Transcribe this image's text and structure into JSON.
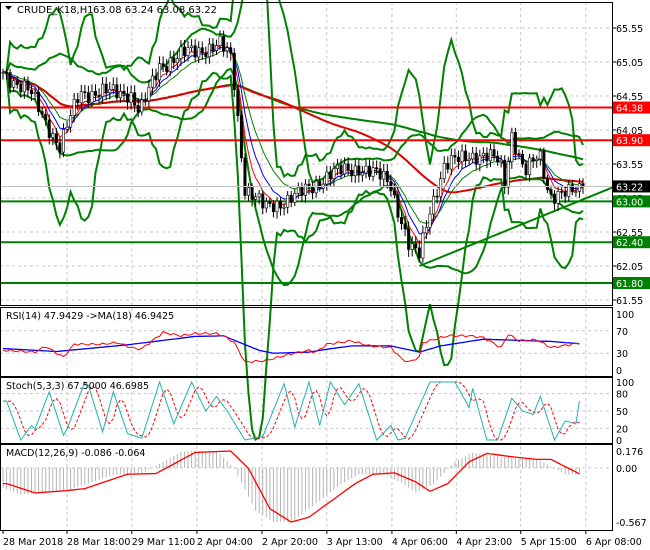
{
  "header": {
    "symbol_label": "CRUDE_K18,H1",
    "ohlc": "63.08 63.24 63.08 63.22"
  },
  "chart_data": {
    "type": "candlestick",
    "title": "CRUDE_K18,H1 63.08 63.24 63.08 63.22",
    "bars": 163,
    "ylim": [
      61.55,
      65.55
    ],
    "price_ticks": [
      "65.55",
      "65.05",
      "64.55",
      "64.05",
      "63.55",
      "63.05",
      "62.55",
      "62.05",
      "61.55"
    ],
    "close_keypoints": [
      [
        0,
        64.9
      ],
      [
        7.6,
        64.6
      ],
      [
        16,
        63.8
      ],
      [
        21.6,
        64.6
      ],
      [
        35.7,
        64.6
      ],
      [
        38.5,
        64.3
      ],
      [
        44,
        65.0
      ],
      [
        52.5,
        65.2
      ],
      [
        61,
        65.3
      ],
      [
        64.3,
        65.1
      ],
      [
        68,
        63.2
      ],
      [
        73.6,
        62.9
      ],
      [
        83.4,
        63.1
      ],
      [
        91.9,
        63.4
      ],
      [
        100,
        63.5
      ],
      [
        108.7,
        63.3
      ],
      [
        111.5,
        62.8
      ],
      [
        114.3,
        62.3
      ],
      [
        117,
        62.2
      ],
      [
        120,
        62.9
      ],
      [
        124,
        63.5
      ],
      [
        131,
        63.7
      ],
      [
        139.6,
        63.6
      ],
      [
        141,
        63.3
      ],
      [
        143,
        64.0
      ],
      [
        146.6,
        63.4
      ],
      [
        150.8,
        63.7
      ],
      [
        153.6,
        63.1
      ],
      [
        159,
        63.1
      ],
      [
        163,
        63.22
      ]
    ],
    "levels": [
      {
        "price": 64.38,
        "label": "64.38",
        "color": "#ff0000"
      },
      {
        "price": 63.9,
        "label": "63.90",
        "color": "#ff0000"
      },
      {
        "price": 63.0,
        "label": "63.00",
        "color": "#008000"
      },
      {
        "price": 62.4,
        "label": "62.40",
        "color": "#008000"
      },
      {
        "price": 61.8,
        "label": "61.80",
        "color": "#008000"
      }
    ],
    "current_price": {
      "price": 63.22,
      "label": "63.22"
    },
    "trendline": {
      "from": [
        117,
        62.05
      ],
      "to": [
        172,
        63.22
      ],
      "color": "#008000"
    },
    "x_labels": [
      {
        "bar": 0,
        "label": "28 Mar 2018"
      },
      {
        "bar": 18,
        "label": "28 Mar 18:00"
      },
      {
        "bar": 36.2,
        "label": "29 Mar 11:00"
      },
      {
        "bar": 54.5,
        "label": "2 Apr 04:00"
      },
      {
        "bar": 72.8,
        "label": "2 Apr 20:00"
      },
      {
        "bar": 91,
        "label": "3 Apr 13:00"
      },
      {
        "bar": 109.3,
        "label": "4 Apr 06:00"
      },
      {
        "bar": 127.4,
        "label": "4 Apr 23:00"
      },
      {
        "bar": 145.5,
        "label": "5 Apr 15:00"
      },
      {
        "bar": 163.8,
        "label": "6 Apr 08:00"
      }
    ],
    "rsi": {
      "title": "RSI(14) 47.9429  ->MA(18) 46.9425",
      "ticks": [
        "100",
        "70",
        "30",
        "0"
      ],
      "rsi_keypoints": [
        [
          1,
          35
        ],
        [
          9,
          32
        ],
        [
          12,
          42
        ],
        [
          17,
          23
        ],
        [
          20,
          46
        ],
        [
          28,
          46
        ],
        [
          32,
          49
        ],
        [
          37,
          38
        ],
        [
          39,
          38
        ],
        [
          45,
          67
        ],
        [
          50,
          61
        ],
        [
          54,
          65
        ],
        [
          60,
          65
        ],
        [
          62,
          61
        ],
        [
          65,
          49
        ],
        [
          68,
          14
        ],
        [
          74,
          17
        ],
        [
          81,
          29
        ],
        [
          86,
          35
        ],
        [
          88,
          32
        ],
        [
          91,
          46
        ],
        [
          98,
          52
        ],
        [
          103,
          43
        ],
        [
          109,
          40
        ],
        [
          112,
          20
        ],
        [
          114,
          14
        ],
        [
          117,
          23
        ],
        [
          118,
          49
        ],
        [
          125,
          61
        ],
        [
          131,
          61
        ],
        [
          135,
          58
        ],
        [
          140,
          40
        ],
        [
          142,
          64
        ],
        [
          145,
          52
        ],
        [
          150,
          54
        ],
        [
          154,
          40
        ],
        [
          162,
          48
        ]
      ],
      "ma_keypoints": [
        [
          1,
          38
        ],
        [
          15,
          33
        ],
        [
          35,
          45
        ],
        [
          54,
          60
        ],
        [
          62,
          61
        ],
        [
          72,
          35
        ],
        [
          76,
          30
        ],
        [
          86,
          32
        ],
        [
          92,
          38
        ],
        [
          98,
          43
        ],
        [
          109,
          43
        ],
        [
          117,
          32
        ],
        [
          123,
          43
        ],
        [
          135,
          55
        ],
        [
          154,
          51
        ],
        [
          162,
          47
        ]
      ]
    },
    "stoch": {
      "title": "Stoch(5,3,3) 67.5000 46.6985",
      "ticks": [
        "100",
        "80",
        "50",
        "20",
        "0"
      ],
      "main_keypoints": [
        [
          1,
          67
        ],
        [
          5,
          0
        ],
        [
          8,
          25
        ],
        [
          9,
          19
        ],
        [
          13,
          83
        ],
        [
          17,
          8
        ],
        [
          18,
          19
        ],
        [
          23,
          100
        ],
        [
          24,
          94
        ],
        [
          28,
          14
        ],
        [
          31,
          83
        ],
        [
          35,
          11
        ],
        [
          39,
          3
        ],
        [
          44,
          100
        ],
        [
          48,
          28
        ],
        [
          53,
          100
        ],
        [
          57,
          50
        ],
        [
          60,
          75
        ],
        [
          63,
          50
        ],
        [
          68,
          0
        ],
        [
          73,
          6
        ],
        [
          79,
          97
        ],
        [
          82,
          22
        ],
        [
          86,
          100
        ],
        [
          89,
          25
        ],
        [
          92,
          100
        ],
        [
          96,
          61
        ],
        [
          100,
          97
        ],
        [
          105,
          0
        ],
        [
          109,
          25
        ],
        [
          111,
          0
        ],
        [
          113,
          3
        ],
        [
          120,
          100
        ],
        [
          127,
          100
        ],
        [
          131,
          56
        ],
        [
          132,
          89
        ],
        [
          136,
          0
        ],
        [
          139,
          0
        ],
        [
          143,
          72
        ],
        [
          146,
          50
        ],
        [
          149,
          44
        ],
        [
          151,
          75
        ],
        [
          155,
          0
        ],
        [
          158,
          33
        ],
        [
          161,
          28
        ],
        [
          162,
          67.5
        ]
      ]
    },
    "macd": {
      "title": "MACD(12,26,9) -0.086 -0.064",
      "ticks": [
        "0.176",
        "0.00",
        "-0.567"
      ],
      "range": [
        -0.567,
        0.176
      ],
      "signal_keypoints": [
        [
          1,
          -0.165
        ],
        [
          9,
          -0.263
        ],
        [
          17,
          -0.242
        ],
        [
          23,
          -0.218
        ],
        [
          35,
          -0.067
        ],
        [
          43,
          -0.06
        ],
        [
          54,
          0.161
        ],
        [
          64,
          0.176
        ],
        [
          69,
          -0.007
        ],
        [
          75,
          -0.428
        ],
        [
          81,
          -0.567
        ],
        [
          86,
          -0.516
        ],
        [
          99,
          -0.165
        ],
        [
          104,
          -0.067
        ],
        [
          110,
          -0.053
        ],
        [
          116,
          -0.147
        ],
        [
          120,
          -0.246
        ],
        [
          125,
          -0.165
        ],
        [
          131,
          0.063
        ],
        [
          136,
          0.151
        ],
        [
          143,
          0.116
        ],
        [
          150,
          0.088
        ],
        [
          154,
          0.088
        ],
        [
          162,
          -0.064
        ]
      ]
    }
  }
}
